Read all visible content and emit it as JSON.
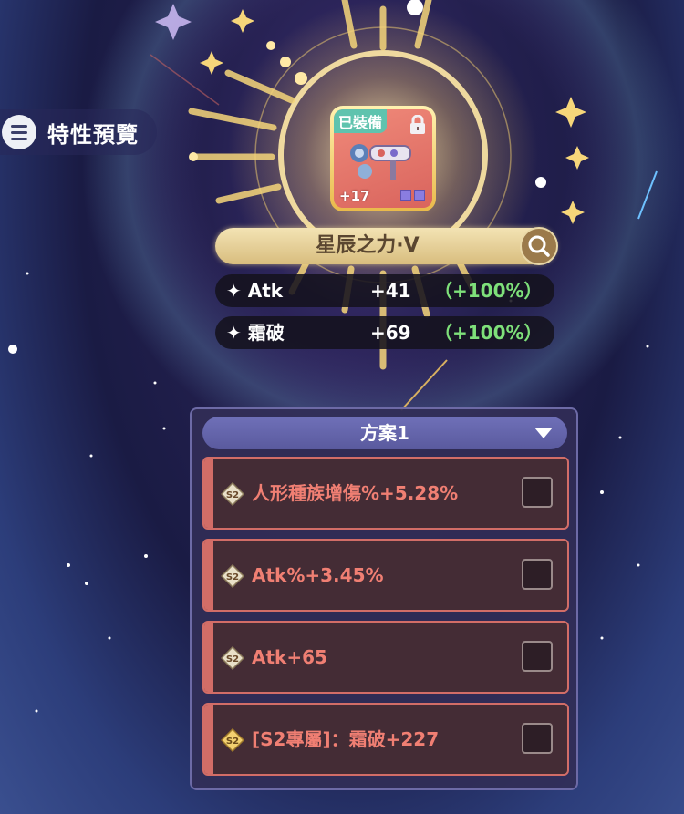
{
  "trait_preview": {
    "label": "特性預覽",
    "icon": "menu-icon"
  },
  "item": {
    "equipped_tag": "已裝備",
    "level": "+17",
    "lock_icon": "lock-icon"
  },
  "item_name": "星辰之力·V",
  "search_icon": "magnifier-icon",
  "stats": [
    {
      "name": "Atk",
      "value": "+41",
      "percent": "（+100%）"
    },
    {
      "name": "霜破",
      "value": "+69",
      "percent": "（+100%）"
    }
  ],
  "plan": {
    "title": "方案1",
    "options": [
      {
        "badge": "S2",
        "text": "人形種族增傷%+5.28%",
        "checked": false
      },
      {
        "badge": "S2",
        "text": "Atk%+3.45%",
        "checked": false
      },
      {
        "badge": "S2",
        "text": "Atk+65",
        "checked": false
      },
      {
        "badge": "S2",
        "text": "[S2專屬]：霜破+227",
        "checked": false
      }
    ]
  },
  "colors": {
    "accent_red": "#d26d67",
    "bonus_green": "#7ee07a",
    "gold": "#f3d070"
  }
}
